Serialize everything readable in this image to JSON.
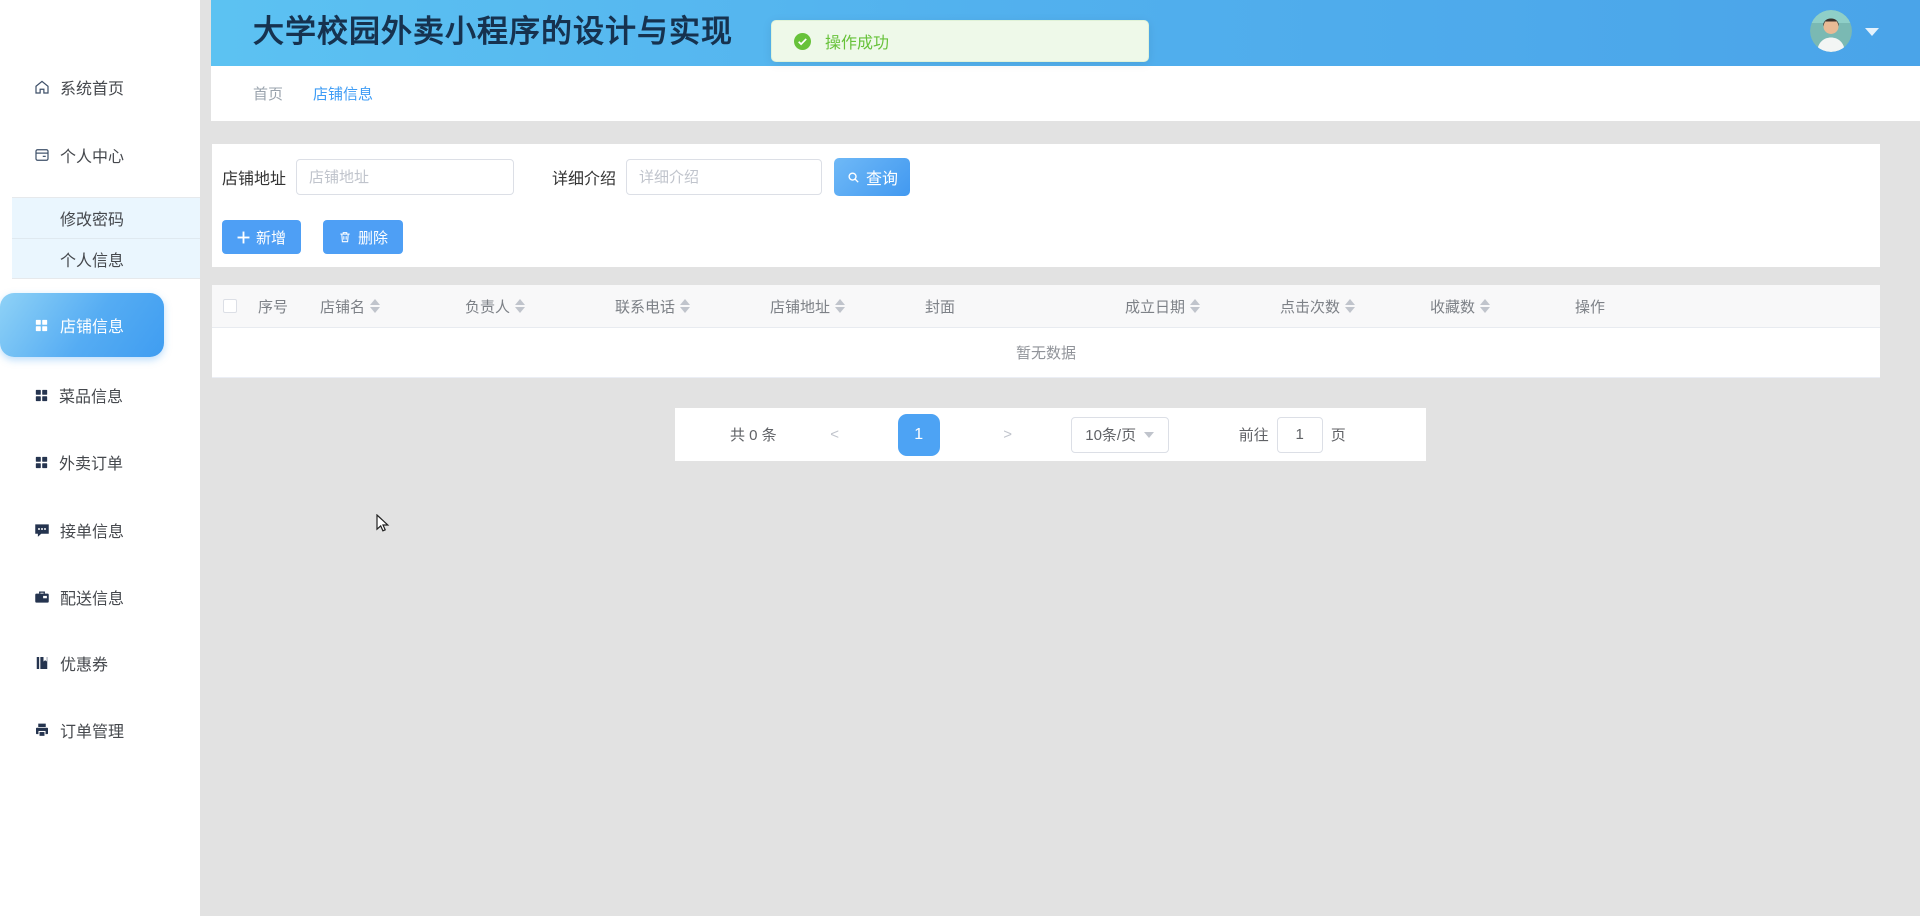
{
  "header": {
    "title": "大学校园外卖小程序的设计与实现"
  },
  "toast": {
    "message": "操作成功"
  },
  "breadcrumb": {
    "items": [
      {
        "label": "首页"
      },
      {
        "label": "店铺信息"
      }
    ]
  },
  "sidebar": {
    "items": [
      {
        "label": "系统首页",
        "icon": "home-icon"
      },
      {
        "label": "个人中心",
        "icon": "workspace-icon"
      },
      {
        "label": "修改密码"
      },
      {
        "label": "个人信息"
      },
      {
        "label": "店铺信息",
        "icon": "grid-icon",
        "active": true
      },
      {
        "label": "菜品信息",
        "icon": "grid-icon"
      },
      {
        "label": "外卖订单",
        "icon": "grid-icon"
      },
      {
        "label": "接单信息",
        "icon": "chat-icon"
      },
      {
        "label": "配送信息",
        "icon": "briefcase-icon"
      },
      {
        "label": "优惠券",
        "icon": "coupon-icon"
      },
      {
        "label": "订单管理",
        "icon": "printer-icon"
      }
    ]
  },
  "search": {
    "address_label": "店铺地址",
    "address_placeholder": "店铺地址",
    "address_value": "",
    "intro_label": "详细介绍",
    "intro_placeholder": "详细介绍",
    "intro_value": "",
    "submit_label": "查询"
  },
  "toolbar": {
    "add_label": "新增",
    "delete_label": "删除"
  },
  "table": {
    "columns": [
      {
        "label": "序号",
        "sortable": false
      },
      {
        "label": "店铺名",
        "sortable": true
      },
      {
        "label": "负责人",
        "sortable": true
      },
      {
        "label": "联系电话",
        "sortable": true
      },
      {
        "label": "店铺地址",
        "sortable": true
      },
      {
        "label": "封面",
        "sortable": false
      },
      {
        "label": "成立日期",
        "sortable": true
      },
      {
        "label": "点击次数",
        "sortable": true
      },
      {
        "label": "收藏数",
        "sortable": true
      },
      {
        "label": "操作",
        "sortable": false
      }
    ],
    "empty_text": "暂无数据"
  },
  "pagination": {
    "total_text": "共 0 条",
    "prev_label": "<",
    "current_page": "1",
    "next_label": ">",
    "page_size": "10条/页",
    "goto_label": "前往",
    "goto_value": "1",
    "goto_unit": "页"
  },
  "colors": {
    "accent": "#4e9ff5",
    "header_blue": "#52b1ee",
    "success": "#67c23a"
  }
}
